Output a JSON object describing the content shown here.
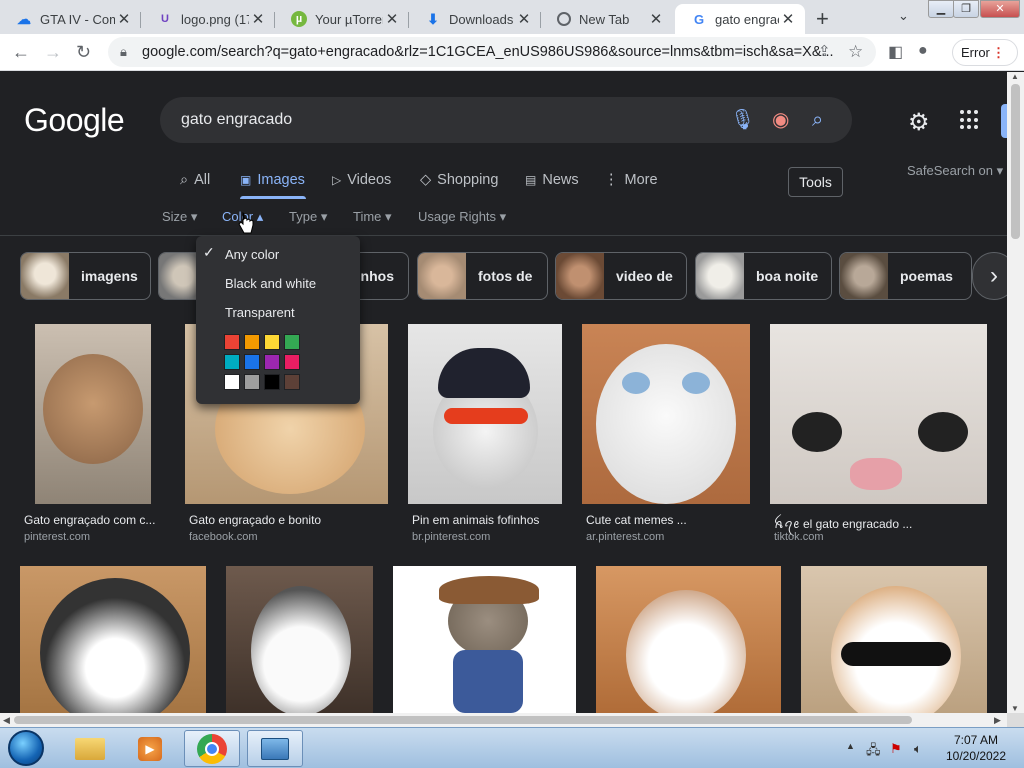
{
  "browser": {
    "tabs": [
      {
        "title": "GTA IV - Com",
        "icon": "cloud-icon",
        "color": "#1a73e8"
      },
      {
        "title": "logo.png (17",
        "icon": "u-logo-icon",
        "color": "#6f42c1"
      },
      {
        "title": "Your µTorren",
        "icon": "utorrent-icon",
        "color": "#76b83f"
      },
      {
        "title": "Downloads",
        "icon": "download-icon",
        "color": "#1a73e8"
      },
      {
        "title": "New Tab",
        "icon": "chrome-icon",
        "color": "#5f6368"
      },
      {
        "title": "gato engracad",
        "icon": "google-icon",
        "color": "#4285f4"
      }
    ],
    "url": "google.com/search?q=gato+engracado&rlz=1C1GCEA_enUS986US986&source=lnms&tbm=isch&sa=X&...",
    "profile_error_label": "Error"
  },
  "google": {
    "logo": "Google",
    "query": "gato engracado",
    "nav_tabs": [
      {
        "label": "All",
        "icon": "search-icon"
      },
      {
        "label": "Images",
        "icon": "image-icon"
      },
      {
        "label": "Videos",
        "icon": "video-icon"
      },
      {
        "label": "Shopping",
        "icon": "tag-icon"
      },
      {
        "label": "News",
        "icon": "news-icon"
      },
      {
        "label": "More",
        "icon": "more-dots-icon"
      }
    ],
    "tools_label": "Tools",
    "safesearch_label": "SafeSearch on",
    "filters": [
      "Size",
      "Color",
      "Type",
      "Time",
      "Usage Rights"
    ],
    "color_menu": {
      "options": [
        "Any color",
        "Black and white",
        "Transparent"
      ],
      "selected": "Any color",
      "swatches": [
        "#ea4335",
        "#f29900",
        "#fdd835",
        "#34a853",
        "#00acc1",
        "#1a73e8",
        "#9c27b0",
        "#e91e63",
        "#ffffff",
        "#9e9e9e",
        "#000000",
        "#5d4037"
      ]
    },
    "chips": [
      "imagens",
      "nhos",
      "fotos de",
      "video de",
      "boa noite",
      "poemas"
    ],
    "results_row1": [
      {
        "caption": "Gato engraçado com c...",
        "source": "pinterest.com"
      },
      {
        "caption": "Gato engraçado e bonito",
        "source": "facebook.com"
      },
      {
        "caption": "Pin em animais fofinhos",
        "source": "br.pinterest.com"
      },
      {
        "caption": "Cute cat memes ...",
        "source": "ar.pinterest.com"
      },
      {
        "caption": "ꫝꪖꫀ el gato engracado ...",
        "source": "tiktok.com"
      }
    ]
  },
  "taskbar": {
    "time": "7:07 AM",
    "date": "10/20/2022"
  }
}
